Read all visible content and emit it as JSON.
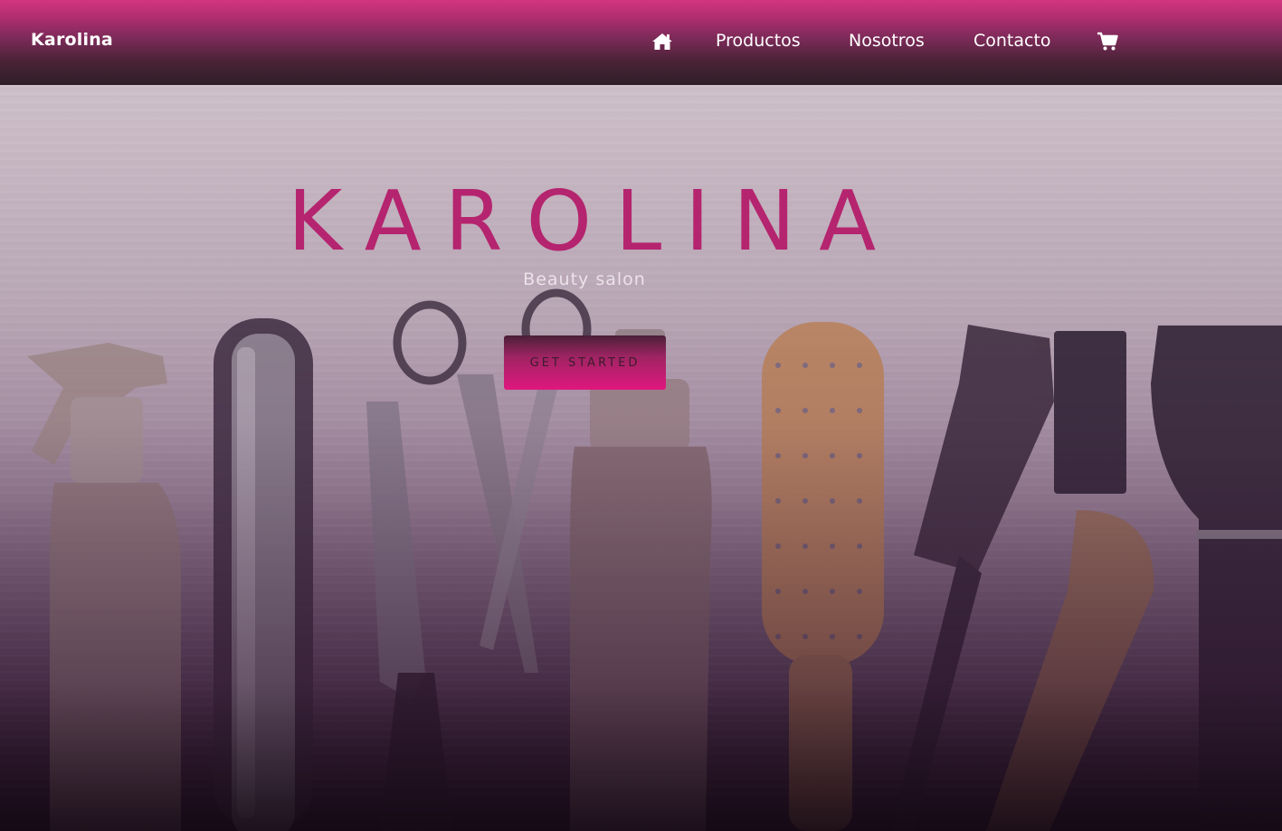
{
  "navbar": {
    "brand": "Karolina",
    "home_icon": "home-icon",
    "links": [
      "Productos",
      "Nosotros",
      "Contacto"
    ],
    "cart_icon": "shopping-cart-icon"
  },
  "hero": {
    "title": "KAROLINA",
    "subtitle": "Beauty salon",
    "cta_label": "GET STARTED"
  },
  "colors": {
    "accent": "#d2357f",
    "title": "#b5246f",
    "button": "#e0177e",
    "nav_dark": "#2e1f28"
  }
}
